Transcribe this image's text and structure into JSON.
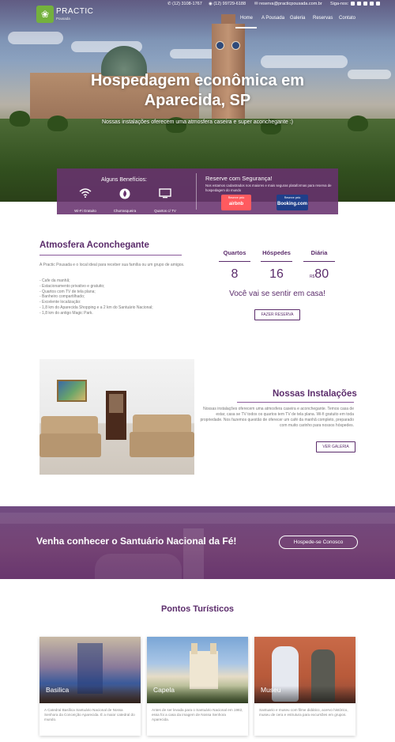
{
  "topbar": {
    "phone1": "(12) 3108-1767",
    "phone2": "(12) 99729-6188",
    "email": "reserva@practicpousada.com.br",
    "follow_label": "Siga-nos:"
  },
  "brand": {
    "name": "PRACTIC",
    "sub": "Pousada"
  },
  "nav": {
    "items": [
      "Home",
      "A Pousada",
      "Galeria",
      "Reservas",
      "Contato"
    ]
  },
  "hero": {
    "title_line1": "Hospedagem econômica em",
    "title_line2": "Aparecida, SP",
    "subtitle": "Nossas instalações oferecem uma atmosfera caseira e super aconchegante :)"
  },
  "benefits": {
    "title": "Alguns Benefícios:",
    "items": [
      {
        "label": "Wi-Fi Gratuito",
        "icon": "wifi-icon"
      },
      {
        "label": "Churrasqueira",
        "icon": "flame-icon"
      },
      {
        "label": "Quartos c/ TV",
        "icon": "tv-icon"
      }
    ]
  },
  "secure": {
    "title": "Reserve com Segurança!",
    "text": "Nos estamos cadastrados nos maiores e mais seguras plataformas para reserva de hospedagem do mundo",
    "airbnb_small": "Reserve pelo",
    "airbnb_brand": "airbnb",
    "booking_small": "Reserve pelo",
    "booking_brand": "Booking.com"
  },
  "atmosfera": {
    "heading": "Atmosfera Aconchegante",
    "intro": "A Practic Pousada e o local ideal para receber sua família ou um grupo de amigos.",
    "list": [
      "- Cafe da manhã;",
      "- Estacionamento privativo e gratuito;",
      "- Quartos com TV de tela plana;",
      "- Banheiro compartilhado;",
      "- Excelente localização:",
      "- 1,8 km do Aparecida Shopping e a 2 km do Santuário Nacional;",
      "- 1,8 km do antigo Magic Park."
    ]
  },
  "stats": [
    {
      "label": "Quartos",
      "value": "8",
      "prefix": ""
    },
    {
      "label": "Hóspedes",
      "value": "16",
      "prefix": ""
    },
    {
      "label": "Diária",
      "value": "80",
      "prefix": "R$"
    }
  ],
  "tagline": "Você vai se sentir em casa!",
  "reserve_button": "FAZER RESERVA",
  "instalacoes": {
    "heading": "Nossas Instalações",
    "text": "Nossas instalações oferecem uma atmosfera caseira e aconchegante. Temos casa de estar, casa se TV todos os quartos tem TV de tela plana. Wi-fi gratuito em toda propriedade. Nos fazemos questão de oferecer um café da manhã completo, preparado com muito carinho para nossos hóspedes.",
    "button": "VER GALERIA"
  },
  "banner": {
    "title": "Venha conhecer o Santuário Nacional da Fé!",
    "button": "Hospede-se Conosco"
  },
  "pontos": {
    "heading": "Pontos Turísticos",
    "cards": [
      {
        "label": "Basilica",
        "desc": "A Catedral Basílica Santuário Nacional de Nossa Senhora da Conceição Aparecida. É a maior catedral do mundo."
      },
      {
        "label": "Capela",
        "desc": "Antes de ser levada para o Santuário Nacional em 1982, essa foi a casa da imagem de Nossa Senhora Aparecida."
      },
      {
        "label": "Museu",
        "desc": "Santuario e museu com filme didático, acervo histórico, museu de cera e estrutura para excursões em grupos."
      }
    ]
  },
  "colors": {
    "primary": "#5b2c6b",
    "brand_green": "#74b13d",
    "airbnb": "#ff5a5f",
    "booking": "#1f3f8a"
  }
}
